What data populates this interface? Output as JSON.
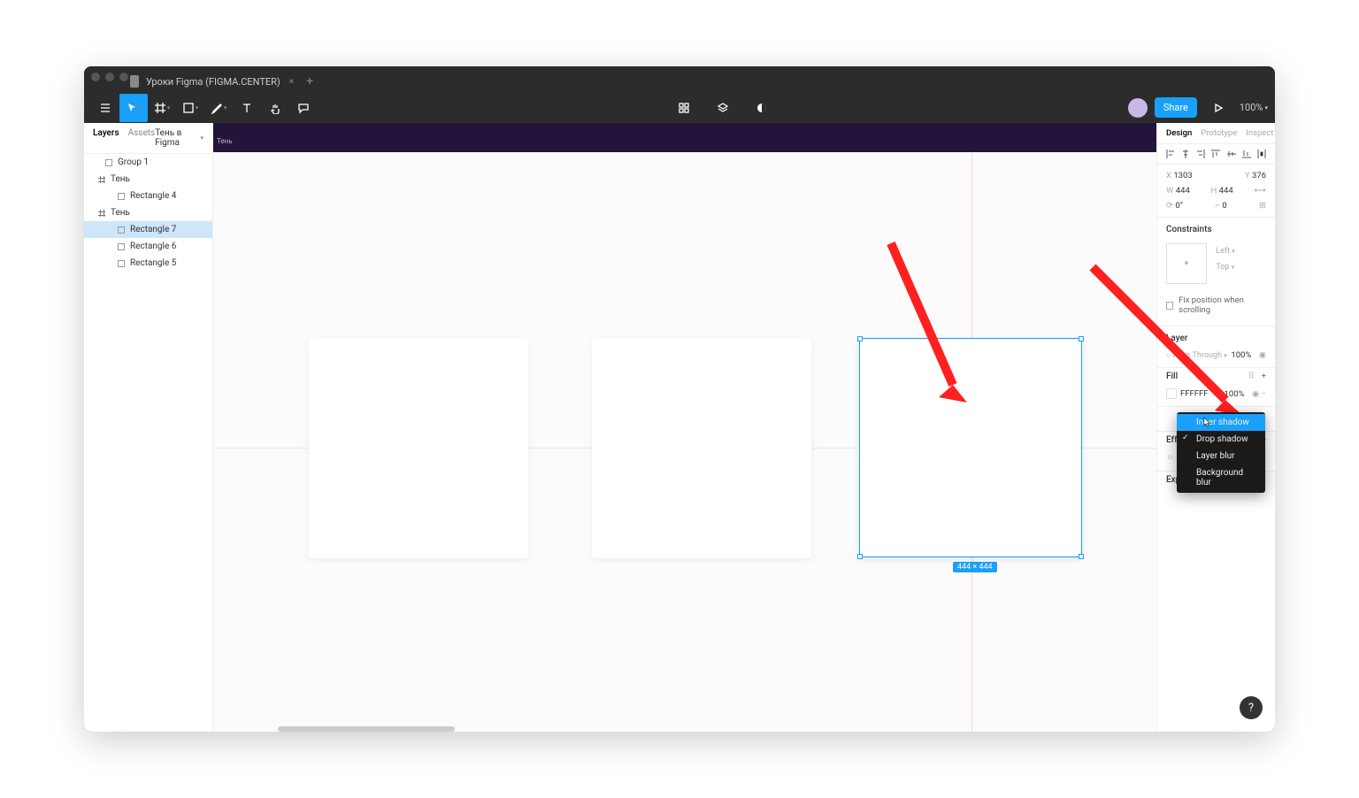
{
  "tab_title": "Уроки Figma (FIGMA.CENTER)",
  "share_button": "Share",
  "zoom": "100%",
  "left_panel": {
    "tab_layers": "Layers",
    "tab_assets": "Assets",
    "page_name": "Тень в Figma",
    "layers": [
      {
        "type": "group",
        "name": "Group 1",
        "indent": 1
      },
      {
        "type": "frame",
        "name": "Тень",
        "indent": 0
      },
      {
        "type": "rect",
        "name": "Rectangle 4",
        "indent": 2
      },
      {
        "type": "frame",
        "name": "Тень",
        "indent": 0
      },
      {
        "type": "rect",
        "name": "Rectangle 7",
        "indent": 2,
        "selected": true
      },
      {
        "type": "rect",
        "name": "Rectangle 6",
        "indent": 2
      },
      {
        "type": "rect",
        "name": "Rectangle 5",
        "indent": 2
      }
    ]
  },
  "canvas": {
    "frame_label": "Тень",
    "dimensions_badge": "444 × 444"
  },
  "right_panel": {
    "tab_design": "Design",
    "tab_prototype": "Prototype",
    "tab_inspect": "Inspect",
    "x": "1303",
    "y": "376",
    "w": "444",
    "h": "444",
    "rotation": "0°",
    "radius": "0",
    "constraints_title": "Constraints",
    "constraint_h": "Left",
    "constraint_v": "Top",
    "fix_scroll": "Fix position when scrolling",
    "layer_title": "Layer",
    "blend_mode": "Pass Through",
    "opacity": "100%",
    "fill_title": "Fill",
    "fill_hex": "FFFFFF",
    "fill_opacity": "100%",
    "effects_title": "Effects",
    "export_title": "Export",
    "dropdown": {
      "inner_shadow": "Inner shadow",
      "drop_shadow": "Drop shadow",
      "layer_blur": "Layer blur",
      "background_blur": "Background blur"
    }
  },
  "help": "?"
}
